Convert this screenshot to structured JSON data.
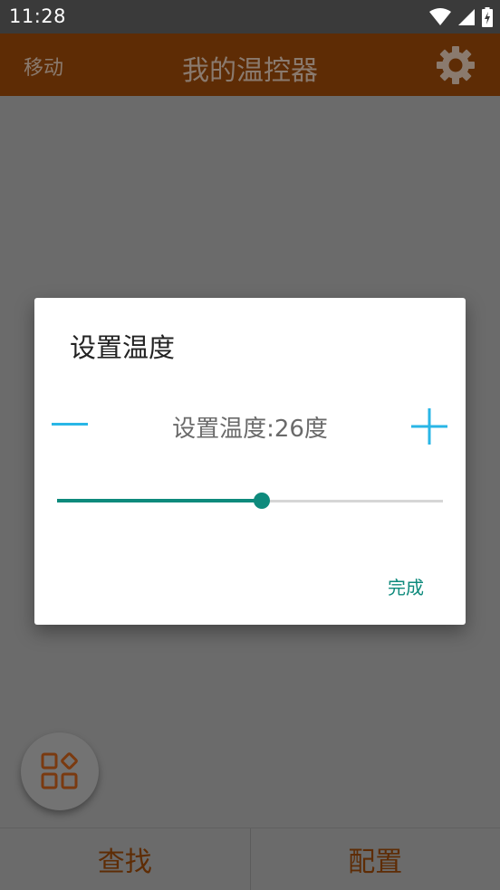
{
  "status_bar": {
    "time": "11:28"
  },
  "app_bar": {
    "left_label": "移动",
    "title": "我的温控器"
  },
  "bottom_nav": {
    "tabs": [
      "查找",
      "配置"
    ]
  },
  "dialog": {
    "title": "设置温度",
    "value_text": "设置温度:26度",
    "slider_fraction": 0.53,
    "done_label": "完成"
  },
  "colors": {
    "app_bar": "#5e2c05",
    "accent": "#0e8a7c",
    "stepper": "#29b6e6"
  },
  "icons": {
    "settings": "gear-icon",
    "minus": "minus-icon",
    "plus": "plus-icon",
    "fab": "apps-grid-icon"
  }
}
